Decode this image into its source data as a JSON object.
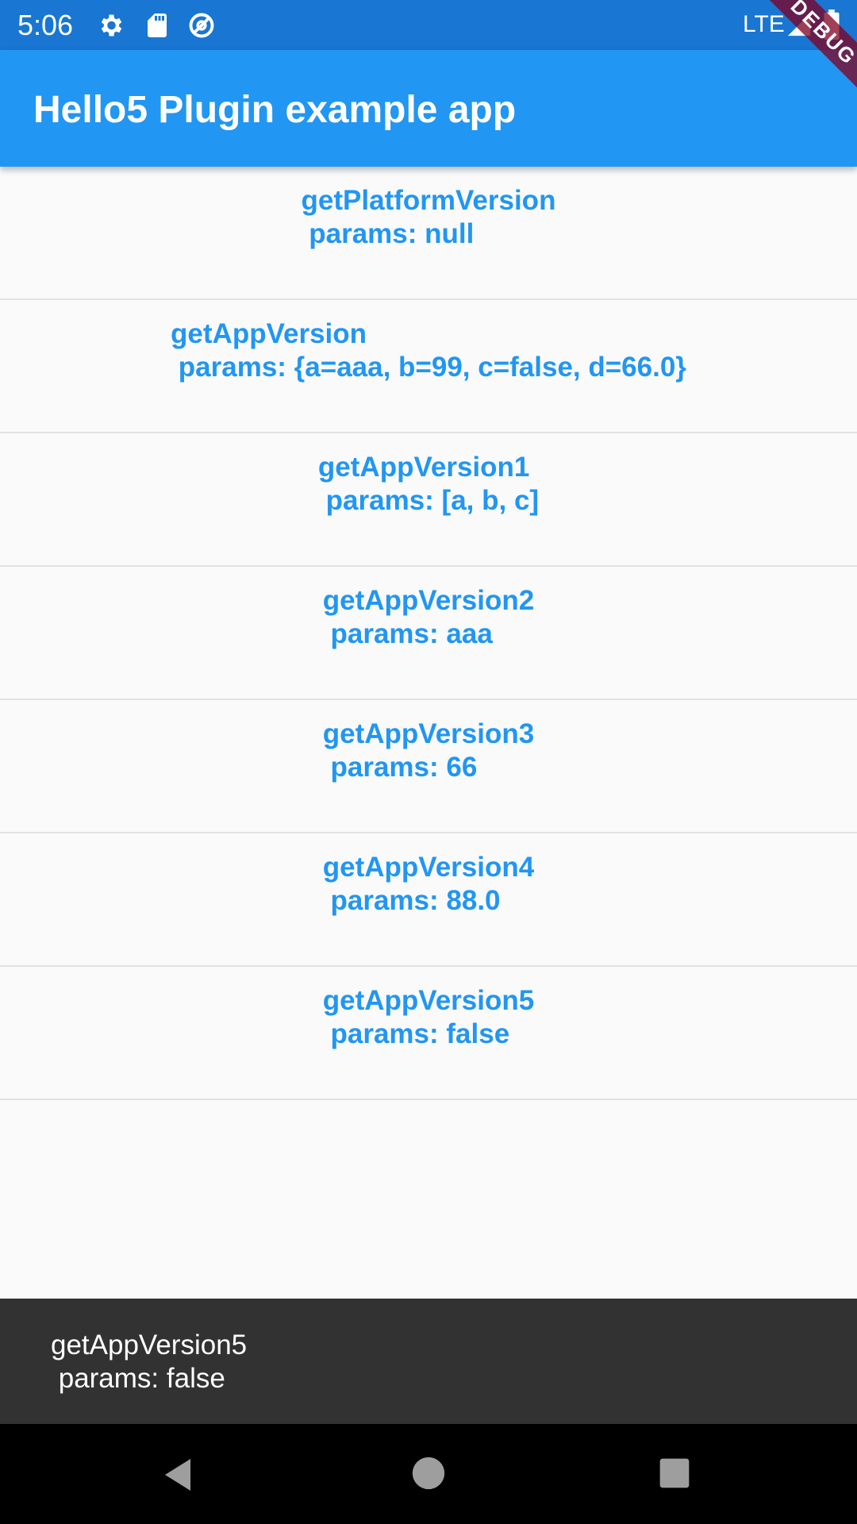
{
  "status_bar": {
    "time": "5:06",
    "network": "LTE",
    "icons": [
      "gear-icon",
      "sd-card-icon",
      "sync-icon",
      "signal-icon",
      "battery-icon"
    ]
  },
  "app_bar": {
    "title": "Hello5 Plugin example app"
  },
  "debug_banner": "DEBUG",
  "methods": [
    {
      "label": "getPlatformVersion\n params: null"
    },
    {
      "label": "getAppVersion\n params: {a=aaa, b=99, c=false, d=66.0}"
    },
    {
      "label": "getAppVersion1\n params: [a, b, c]"
    },
    {
      "label": "getAppVersion2\n params: aaa"
    },
    {
      "label": "getAppVersion3\n params: 66"
    },
    {
      "label": "getAppVersion4\n params: 88.0"
    },
    {
      "label": "getAppVersion5\n params: false"
    }
  ],
  "snackbar": {
    "message": "getAppVersion5\n params: false"
  },
  "nav_bar": {
    "buttons": [
      "back-icon",
      "home-icon",
      "recents-icon"
    ]
  },
  "colors": {
    "status_bar": "#1976d2",
    "app_bar": "#2196f3",
    "accent_text": "#2196f3",
    "background": "#fafafa",
    "snackbar": "#323232",
    "debug_ribbon": "#800020"
  }
}
